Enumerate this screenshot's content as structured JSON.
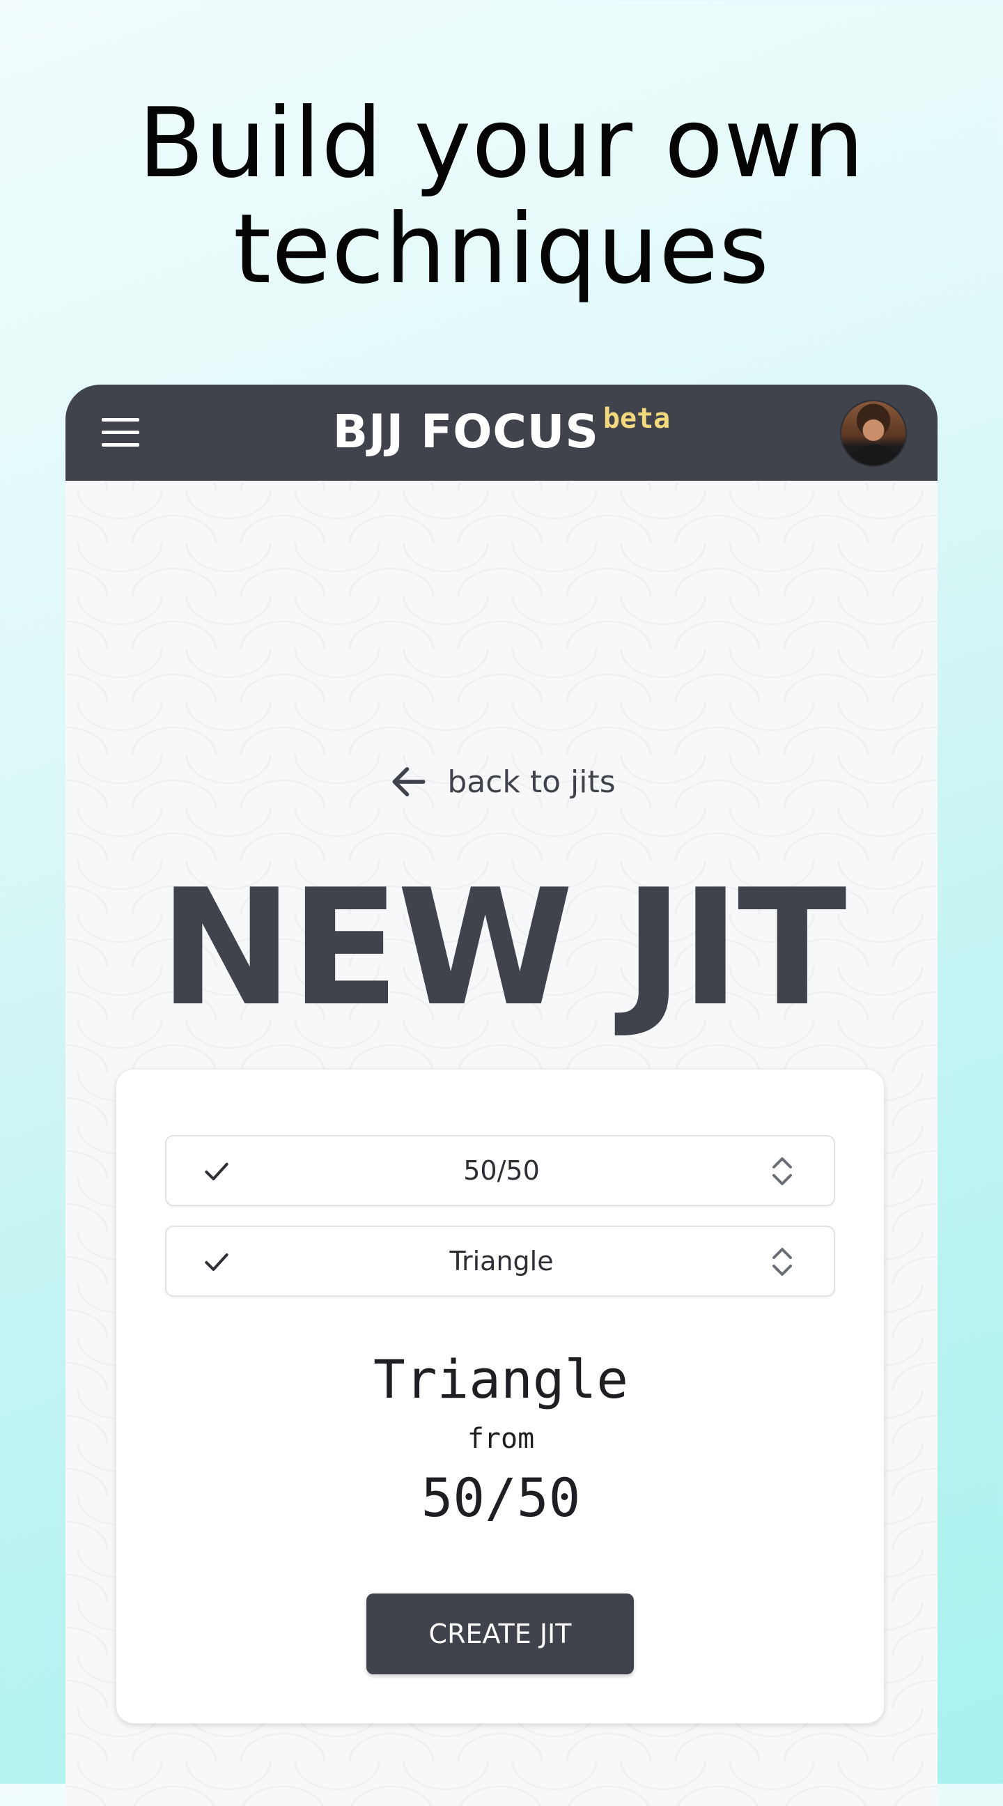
{
  "promo": {
    "headline_line1": "Build your own",
    "headline_line2": "techniques"
  },
  "header": {
    "brand": "BJJ FOCUS",
    "brand_badge": "beta",
    "menu_icon": "hamburger-menu-icon",
    "avatar_icon": "user-avatar"
  },
  "nav": {
    "back_label": "back to jits",
    "back_icon": "arrow-left-icon"
  },
  "page": {
    "title": "NEW JIT"
  },
  "form": {
    "position_select": {
      "value": "50/50",
      "check_icon": "check-icon",
      "chevron_icon": "chevron-up-down-icon"
    },
    "technique_select": {
      "value": "Triangle",
      "check_icon": "check-icon",
      "chevron_icon": "chevron-up-down-icon"
    }
  },
  "preview": {
    "technique": "Triangle",
    "connector": "from",
    "position": "50/50"
  },
  "actions": {
    "create_label": "CREATE JIT"
  },
  "colors": {
    "primary": "#40434b",
    "badge": "#f3d97c",
    "background_gradient_end": "#a8f1ef"
  }
}
